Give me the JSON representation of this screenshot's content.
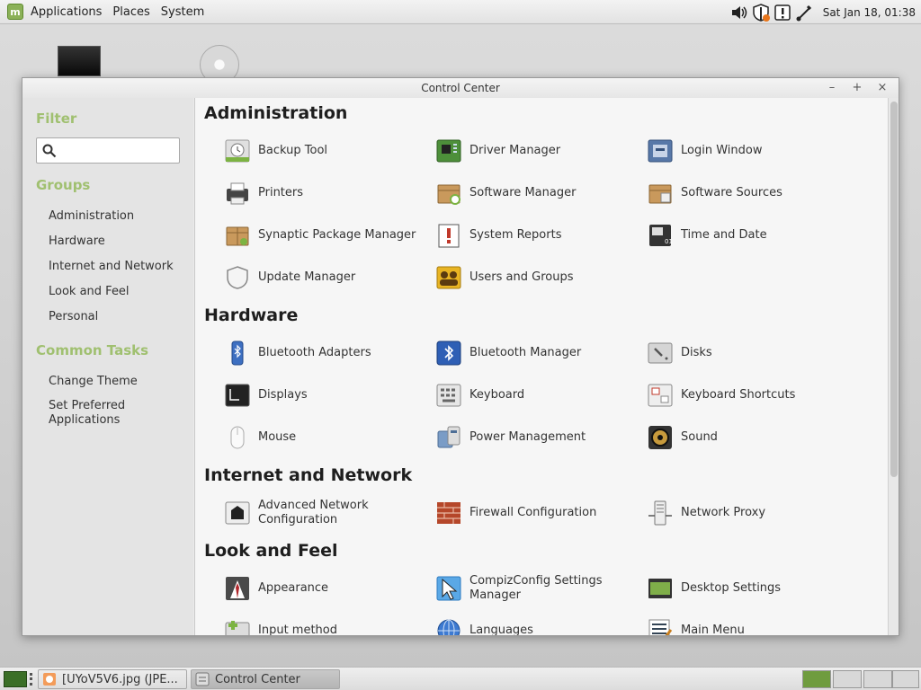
{
  "top_panel": {
    "menus": [
      "Applications",
      "Places",
      "System"
    ],
    "clock": "Sat Jan 18, 01:38"
  },
  "window": {
    "title": "Control Center",
    "controls": {
      "minimize": "–",
      "maximize": "+",
      "close": "×"
    }
  },
  "sidebar": {
    "filter_heading": "Filter",
    "filter_placeholder": "",
    "groups_heading": "Groups",
    "groups": [
      "Administration",
      "Hardware",
      "Internet and Network",
      "Look and Feel",
      "Personal"
    ],
    "tasks_heading": "Common Tasks",
    "tasks": [
      "Change Theme",
      "Set Preferred Applications"
    ]
  },
  "sections": [
    {
      "title": "Administration",
      "items": [
        {
          "label": "Backup Tool",
          "icon": "backup-tool-icon"
        },
        {
          "label": "Driver Manager",
          "icon": "driver-manager-icon"
        },
        {
          "label": "Login Window",
          "icon": "login-window-icon"
        },
        {
          "label": "Printers",
          "icon": "printers-icon"
        },
        {
          "label": "Software Manager",
          "icon": "software-manager-icon"
        },
        {
          "label": "Software Sources",
          "icon": "software-sources-icon"
        },
        {
          "label": "Synaptic Package Manager",
          "icon": "synaptic-icon"
        },
        {
          "label": "System Reports",
          "icon": "system-reports-icon"
        },
        {
          "label": "Time and Date",
          "icon": "time-date-icon"
        },
        {
          "label": "Update Manager",
          "icon": "update-manager-icon"
        },
        {
          "label": "Users and Groups",
          "icon": "users-groups-icon"
        }
      ]
    },
    {
      "title": "Hardware",
      "items": [
        {
          "label": "Bluetooth Adapters",
          "icon": "bluetooth-adapters-icon"
        },
        {
          "label": "Bluetooth Manager",
          "icon": "bluetooth-manager-icon"
        },
        {
          "label": "Disks",
          "icon": "disks-icon"
        },
        {
          "label": "Displays",
          "icon": "displays-icon"
        },
        {
          "label": "Keyboard",
          "icon": "keyboard-icon"
        },
        {
          "label": "Keyboard Shortcuts",
          "icon": "keyboard-shortcuts-icon"
        },
        {
          "label": "Mouse",
          "icon": "mouse-icon"
        },
        {
          "label": "Power Management",
          "icon": "power-management-icon"
        },
        {
          "label": "Sound",
          "icon": "sound-icon"
        }
      ]
    },
    {
      "title": "Internet and Network",
      "items": [
        {
          "label": "Advanced Network Configuration",
          "icon": "network-config-icon"
        },
        {
          "label": "Firewall Configuration",
          "icon": "firewall-icon"
        },
        {
          "label": "Network Proxy",
          "icon": "network-proxy-icon"
        }
      ]
    },
    {
      "title": "Look and Feel",
      "items": [
        {
          "label": "Appearance",
          "icon": "appearance-icon"
        },
        {
          "label": "CompizConfig Settings Manager",
          "icon": "compizconfig-icon"
        },
        {
          "label": "Desktop Settings",
          "icon": "desktop-settings-icon"
        },
        {
          "label": "Input method",
          "icon": "input-method-icon"
        },
        {
          "label": "Languages",
          "icon": "languages-icon"
        },
        {
          "label": "Main Menu",
          "icon": "main-menu-icon"
        }
      ]
    }
  ],
  "taskbar": {
    "tasks": [
      "[UYoV5V6.jpg (JPE...",
      "Control Center"
    ]
  }
}
